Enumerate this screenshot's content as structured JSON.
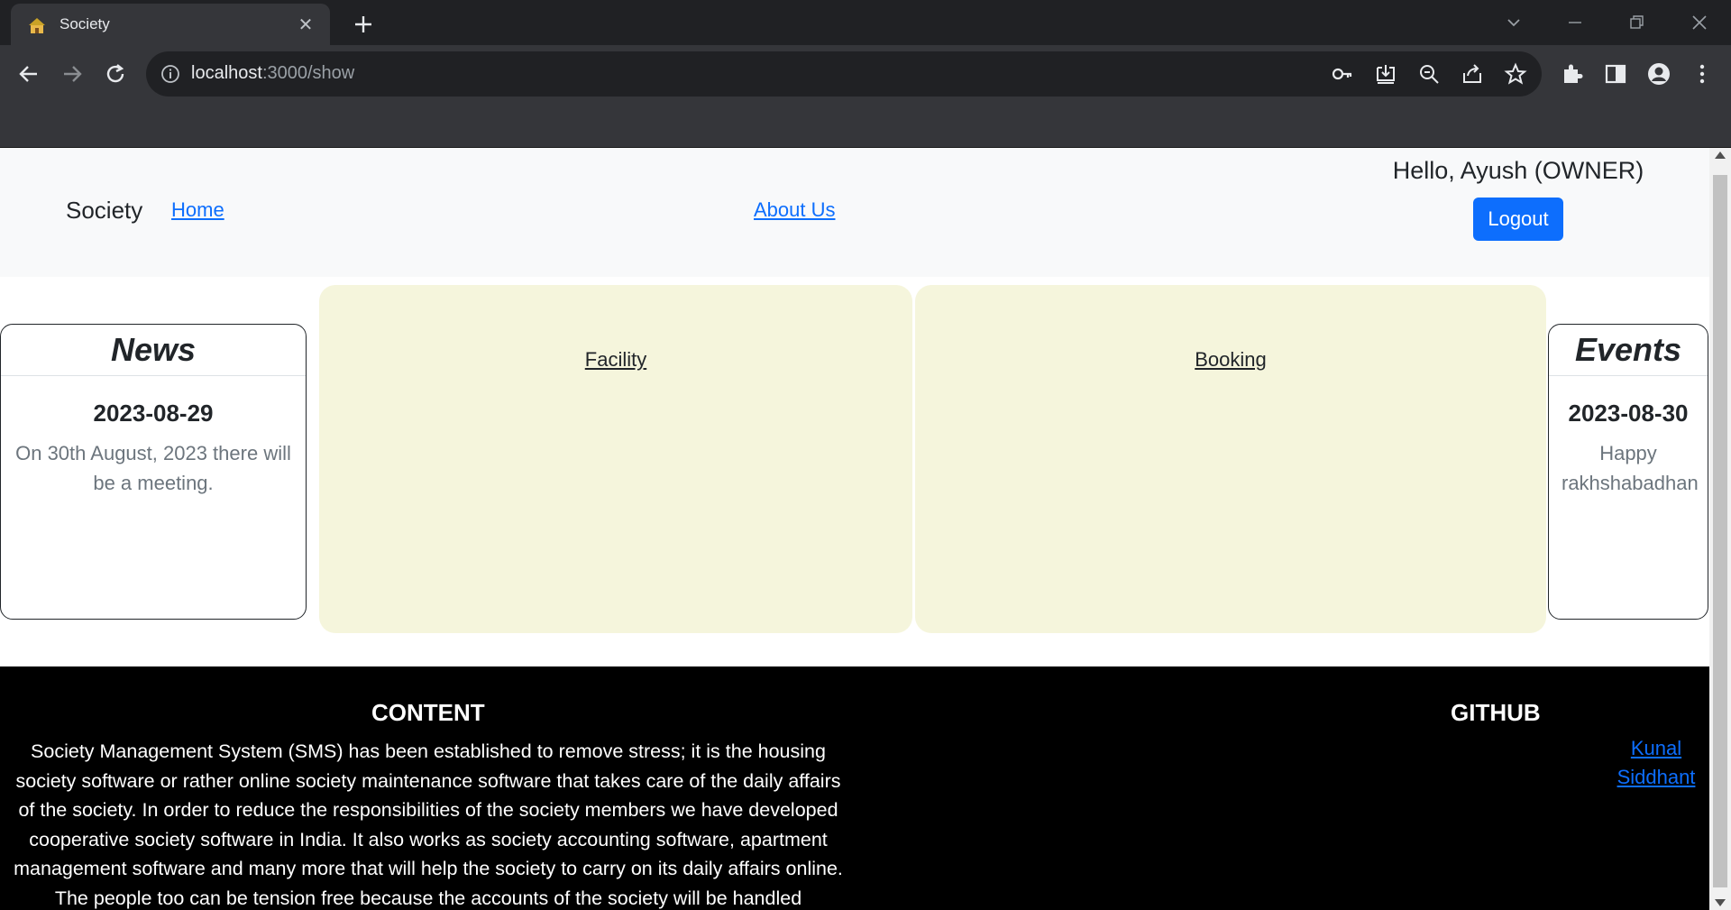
{
  "browser": {
    "tab_title": "Society",
    "url_host": "localhost",
    "url_path": ":3000/show"
  },
  "site": {
    "brand": "Society",
    "nav": {
      "home": "Home",
      "about": "About Us"
    },
    "greeting": "Hello, Ayush (OWNER)",
    "logout": "Logout"
  },
  "news": {
    "title": "News",
    "date": "2023-08-29",
    "text": "On 30th August, 2023 there will be a meeting."
  },
  "events": {
    "title": "Events",
    "date": "2023-08-30",
    "text": "Happy rakhshabadhan"
  },
  "tiles": {
    "facility": "Facility",
    "booking": "Booking"
  },
  "footer": {
    "content_heading": "CONTENT",
    "content_text": "Society Management System (SMS) has been established to remove stress; it is the housing society software or rather online society maintenance software that takes care of the daily affairs of the society. In order to reduce the responsibilities of the society members we have developed cooperative society software in India. It also works as society accounting software, apartment management software and many more that will help the society to carry on its daily affairs online. The people too can be tension free because the accounts of the society will be handled",
    "github_heading": "GITHUB",
    "github_links": [
      "Kunal",
      "Siddhant"
    ]
  },
  "colors": {
    "primary": "#0d6efd",
    "tile_bg": "#f5f5dc",
    "footer_bg": "#000000",
    "nav_bg": "#f8f9fa"
  }
}
